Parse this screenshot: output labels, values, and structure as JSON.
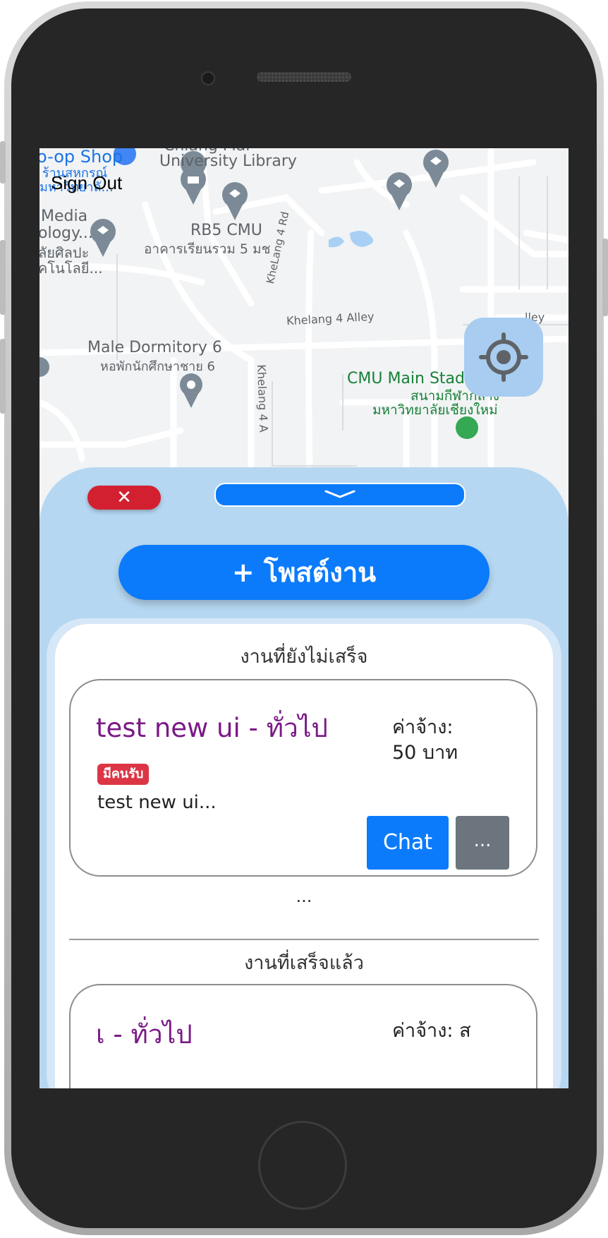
{
  "app": {
    "sign_out_label": "Sign Out"
  },
  "map": {
    "labels": {
      "coop_shop": "o-op Shop",
      "coop_shop_th": "ร้านสหกรณ์",
      "coop_shop_th2": "มหาวิทยาลั...",
      "library_line1": "Chiang Mai",
      "library_line2": "University Library",
      "media_line1": "Media",
      "media_line2": "ology...",
      "media_line3": "ลัยศิลปะ",
      "media_line4": "คโนโลยี...",
      "rb5": "RB5 CMU",
      "rb5_th": "อาคารเรียนรวม 5 มช",
      "khelang_4_rd": "KheLang 4 Rd",
      "khelang_4_alley": "Khelang 4 Alley",
      "khelang_4_alley_2": "Khelang 4 A",
      "alley_right": "lley",
      "male_dorm": "Male Dormitory 6",
      "male_dorm_th": "หอพักนักศึกษาชาย 6",
      "stadium": "CMU Main Stadium",
      "stadium_th1": "สนามกีฬากลาง",
      "stadium_th2": "มหาวิทยาลัยเชียงใหม่"
    },
    "colors": {
      "background": "#f1f3f4",
      "road": "#ffffff",
      "pin": "#7b8a96",
      "stadium_text": "#188038",
      "water": "#a8d0f5"
    },
    "icons": [
      "shop-pin-icon",
      "book-pin-icon",
      "graduation-cap-pin-icon",
      "location-pin-icon",
      "stadium-pin-icon",
      "my-location-icon"
    ]
  },
  "sheet": {
    "close_symbol": "✕",
    "collapse_icon": "chevron-down-icon",
    "post_button_label": "+ โพสต์งาน",
    "colors": {
      "sheet_bg": "#b6d7f1",
      "primary": "#0b7bfb",
      "danger": "#dc3545",
      "secondary": "#6c757d",
      "title": "#7a1a86"
    }
  },
  "pending": {
    "section_title": "งานที่ยังไม่เสร็จ",
    "jobs": [
      {
        "title": "test new ui - ทั่วไป",
        "pay_label": "ค่าจ้าง:",
        "pay_value": "50 บาท",
        "status_badge": "มีคนรับ",
        "description": "test new ui...",
        "chat_label": "Chat",
        "more_label": "..."
      }
    ],
    "more_indicator": "..."
  },
  "completed": {
    "section_title": "งานที่เสร็จแล้ว",
    "jobs": [
      {
        "title": "เ - ทั่วไป",
        "pay_label": "ค่าจ้าง: ส"
      }
    ]
  }
}
